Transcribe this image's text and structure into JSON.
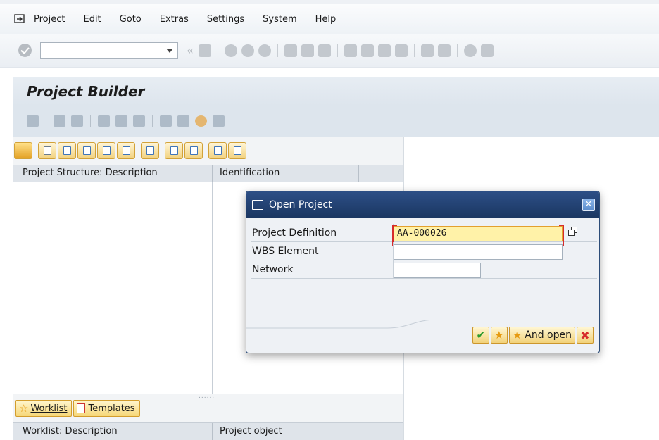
{
  "menubar": {
    "items": [
      "Project",
      "Edit",
      "Goto",
      "Extras",
      "Settings",
      "System",
      "Help"
    ]
  },
  "toolbar": {
    "command_field_value": "",
    "icons": [
      "ok-icon",
      "save-icon",
      "back-icon",
      "exit-icon",
      "cancel-icon",
      "print-icon",
      "find-icon",
      "find-next-icon",
      "first-page-icon",
      "previous-page-icon",
      "next-page-icon",
      "last-page-icon",
      "new-session-icon",
      "shortcut-icon",
      "help-icon",
      "layout-icon"
    ]
  },
  "page": {
    "title": "Project Builder"
  },
  "structure": {
    "col1": "Project Structure: Description",
    "col2": "Identification"
  },
  "tabs": {
    "worklist": "Worklist",
    "templates": "Templates"
  },
  "worklist": {
    "col1": "Worklist: Description",
    "col2": "Project object"
  },
  "dialog": {
    "title": "Open Project",
    "fields": [
      {
        "label": "Project Definition",
        "value": "AA-000026"
      },
      {
        "label": "WBS Element",
        "value": ""
      },
      {
        "label": "Network",
        "value": ""
      }
    ],
    "and_open_label": "And open"
  },
  "colors": {
    "dialog_title": "#1f3c6c",
    "active_field": "#fff2a8",
    "button_yellow": "#f2d27a"
  }
}
